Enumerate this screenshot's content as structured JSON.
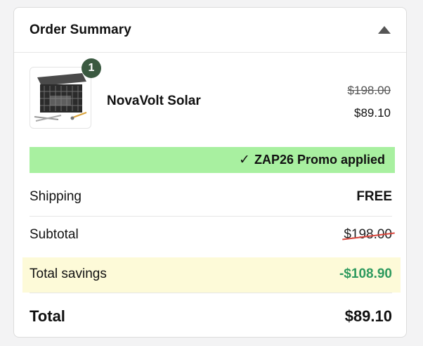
{
  "header": {
    "title": "Order Summary",
    "toggle_icon": "caret-up-icon"
  },
  "product": {
    "quantity": "1",
    "name": "NovaVolt Solar",
    "original_price": "$198.00",
    "price": "$89.10",
    "image": "solar-generator-icon"
  },
  "promo": {
    "check_icon": "✓",
    "text": "ZAP26 Promo applied",
    "color": "#a8f0a0"
  },
  "summary": {
    "shipping_label": "Shipping",
    "shipping_value": "FREE",
    "subtotal_label": "Subtotal",
    "subtotal_value": "$198.00",
    "savings_label": "Total savings",
    "savings_value": "-$108.90",
    "total_label": "Total",
    "total_value": "$89.10"
  },
  "colors": {
    "savings": "#2e9a5e",
    "savings_bg": "#fdfad8",
    "badge": "#3a5940",
    "strike": "#d8463c"
  }
}
